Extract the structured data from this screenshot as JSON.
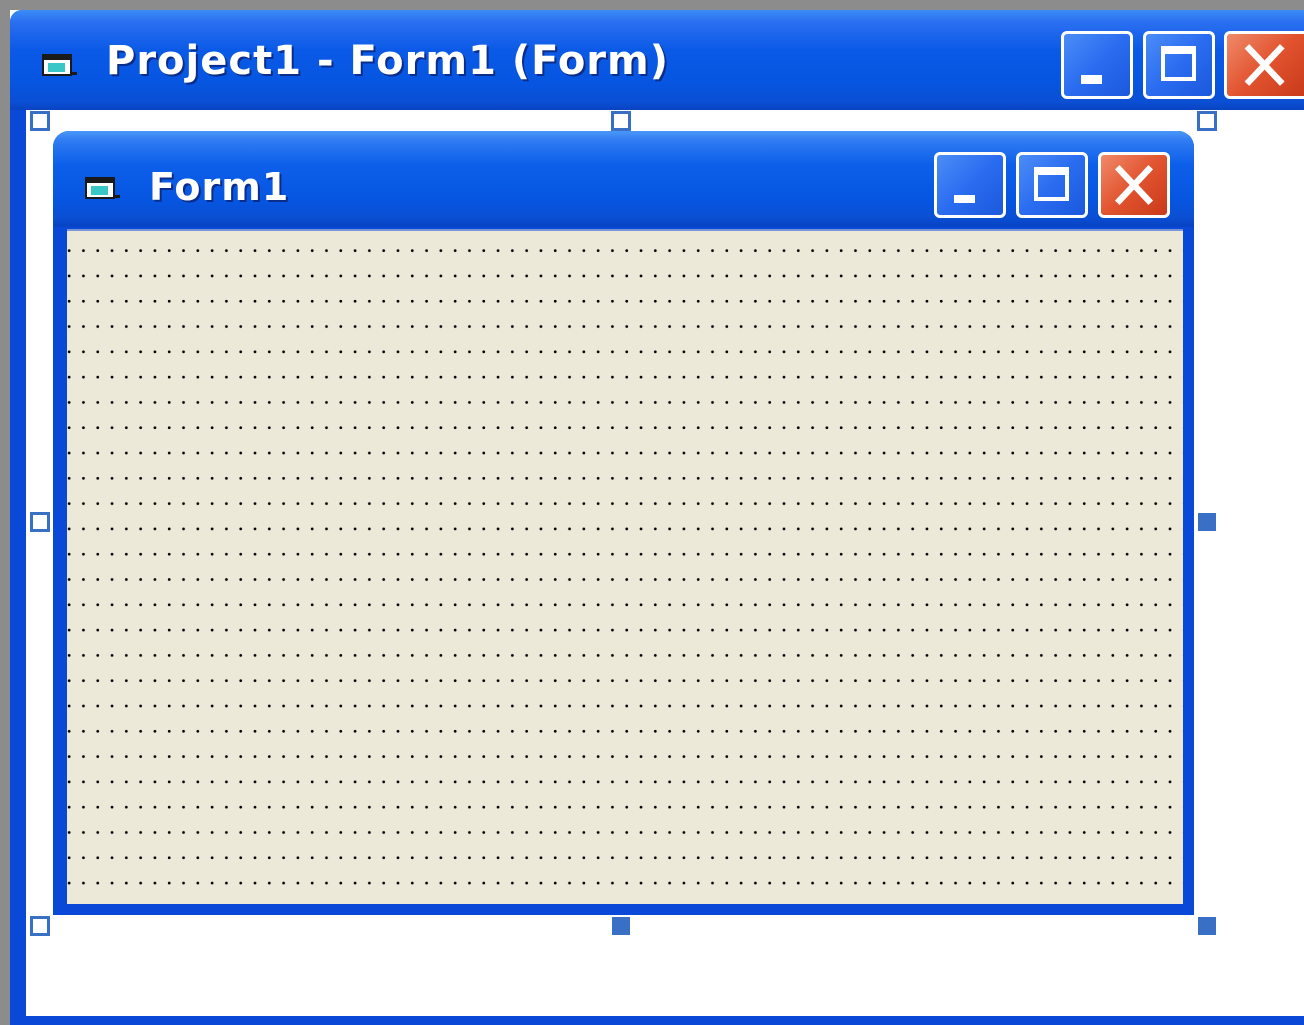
{
  "outer_window": {
    "title": "Project1 - Form1 (Form)",
    "icon": "form-window-icon",
    "buttons": {
      "minimize": "minimize-icon",
      "maximize": "maximize-icon",
      "close": "close-icon"
    }
  },
  "form": {
    "title": "Form1",
    "icon": "form-window-icon",
    "buttons": {
      "minimize": "minimize-icon",
      "maximize": "maximize-icon",
      "close": "close-icon"
    },
    "grid": "dotted design grid"
  },
  "colors": {
    "titlebar_blue": "#0656e2",
    "form_background": "#ece9d8",
    "close_red": "#e2532f",
    "selection_handle": "#3a6fc6"
  }
}
